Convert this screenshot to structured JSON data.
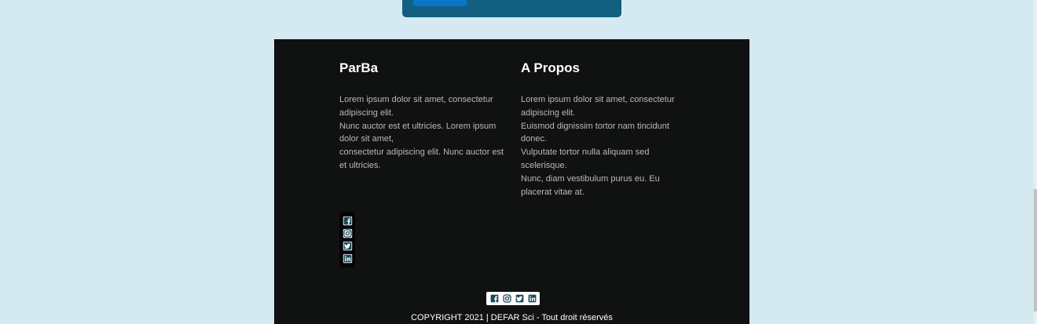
{
  "colors": {
    "page_background": "#d5e9f1",
    "footer_background": "#101111",
    "top_card": "#125f80",
    "top_card_button": "#0a75c8",
    "icon_color": "#1a4a5c"
  },
  "footer": {
    "columns": [
      {
        "title": "ParBa",
        "lines": [
          "Lorem ipsum dolor sit amet, consectetur adipiscing elit.",
          "Nunc auctor est et ultricies. Lorem ipsum dolor sit amet,",
          "consectetur adipiscing elit. Nunc auctor est et ultricies."
        ]
      },
      {
        "title": "A Propos",
        "lines": [
          "Lorem ipsum dolor sit amet, consectetur adipiscing elit.",
          "Euismod dignissim tortor nam tincidunt donec.",
          "Vulputate tortor nulla aliquam sed scelerisque.",
          "Nunc, diam vestibulum purus eu. Eu placerat vitae at."
        ]
      }
    ],
    "social_icons": [
      "facebook-icon",
      "instagram-icon",
      "twitter-icon",
      "linkedin-icon"
    ],
    "copyright": "COPYRIGHT 2021 | DEFAR Sci - Tout droit réservés"
  }
}
